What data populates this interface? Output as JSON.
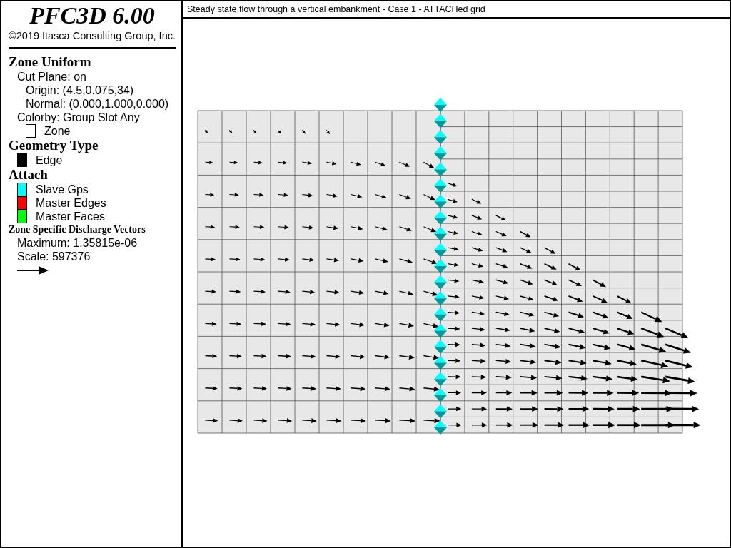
{
  "header": {
    "title": "PFC3D 6.00",
    "copyright": "©2019 Itasca Consulting Group, Inc."
  },
  "legend": [
    {
      "kind": "heading",
      "text": "Zone Uniform",
      "children": [
        {
          "kind": "text",
          "text": "Cut Plane: on",
          "children": [
            {
              "kind": "text",
              "text": "Origin: (4.5,0.075,34)"
            },
            {
              "kind": "text",
              "text": "Normal: (0.000,1.000,0.000)"
            }
          ]
        },
        {
          "kind": "text",
          "text": "Colorby: Group Slot Any",
          "children": [
            {
              "kind": "swatch",
              "text": "Zone",
              "color": "#ffffff"
            }
          ]
        }
      ]
    },
    {
      "kind": "heading",
      "text": "Geometry Type",
      "children": [
        {
          "kind": "swatch",
          "text": "Edge",
          "color": "#000000"
        }
      ]
    },
    {
      "kind": "heading",
      "text": "Attach",
      "children": [
        {
          "kind": "swatch",
          "text": "Slave Gps",
          "color": "#00ffff"
        },
        {
          "kind": "swatch",
          "text": "Master Edges",
          "color": "#ff0000"
        },
        {
          "kind": "swatch",
          "text": "Master Faces",
          "color": "#00ff00"
        }
      ]
    },
    {
      "kind": "subheading",
      "text": "Zone Specific Discharge Vectors",
      "children": [
        {
          "kind": "text",
          "text": "Maximum: 1.35815e-06"
        },
        {
          "kind": "text",
          "text": "Scale: 597376"
        },
        {
          "kind": "arrow"
        }
      ]
    }
  ],
  "plot": {
    "title": "Steady state flow through a vertical embankment - Case 1 - ATTACHed grid"
  }
}
